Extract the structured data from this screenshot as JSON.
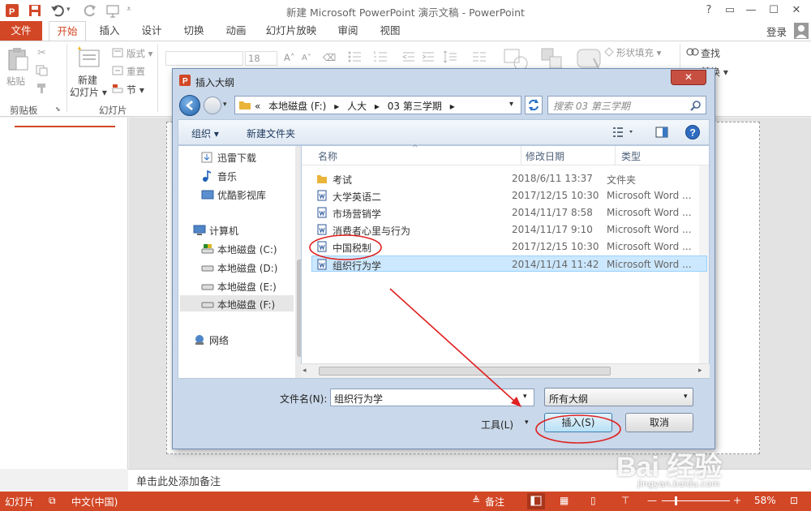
{
  "window": {
    "title": "新建 Microsoft PowerPoint 演示文稿 - PowerPoint",
    "app_icon": "P"
  },
  "window_controls": {
    "help": "?",
    "restore": "▭",
    "minimize": "—",
    "maximize": "☐",
    "close": "✕"
  },
  "tabs": {
    "file": "文件",
    "items": [
      "开始",
      "插入",
      "设计",
      "切换",
      "动画",
      "幻灯片放映",
      "审阅",
      "视图"
    ]
  },
  "signin": "登录",
  "ribbon": {
    "paste": "粘贴",
    "clipboard_group": "剪贴板",
    "new_slide": "新建\n幻灯片",
    "new_slide_line1": "新建",
    "new_slide_line2": "幻灯片 ▾",
    "layout": "版式 ▾",
    "reset": "重置",
    "section": "节 ▾",
    "slides_group": "幻灯片",
    "font_size": "18",
    "shape_fill": "形状填充 ▾",
    "find": "查找",
    "replace": "替换 ▾"
  },
  "dialog": {
    "title": "插入大纲",
    "address": [
      "«",
      "本地磁盘 (F:)",
      "▸",
      "人大",
      "▸",
      "03 第三学期",
      "▸"
    ],
    "search_placeholder": "搜索 03 第三学期",
    "organize": "组织 ▾",
    "new_folder": "新建文件夹",
    "nav_items": {
      "xunlei": "迅雷下载",
      "music": "音乐",
      "youku": "优酷影视库",
      "computer": "计算机",
      "drive_c": "本地磁盘 (C:)",
      "drive_d": "本地磁盘 (D:)",
      "drive_e": "本地磁盘 (E:)",
      "drive_f": "本地磁盘 (F:)",
      "network": "网络"
    },
    "columns": {
      "name": "名称",
      "date": "修改日期",
      "type": "类型"
    },
    "files": [
      {
        "name": "考试",
        "date": "2018/6/11 13:37",
        "type": "文件夹"
      },
      {
        "name": "大学英语二",
        "date": "2017/12/15 10:30",
        "type": "Microsoft Word ..."
      },
      {
        "name": "市场营销学",
        "date": "2014/11/17 8:58",
        "type": "Microsoft Word ..."
      },
      {
        "name": "消费者心里与行为",
        "date": "2014/11/17 9:10",
        "type": "Microsoft Word ..."
      },
      {
        "name": "中国税制",
        "date": "2017/12/15 10:30",
        "type": "Microsoft Word ..."
      },
      {
        "name": "组织行为学",
        "date": "2014/11/14 11:42",
        "type": "Microsoft Word ..."
      }
    ],
    "filename_label": "文件名(N):",
    "filename_value": "组织行为学",
    "filter": "所有大纲",
    "tools": "工具(L)",
    "insert": "插入(S)",
    "cancel": "取消"
  },
  "notes_placeholder": "单击此处添加备注",
  "status": {
    "slide": "幻灯片",
    "language": "中文(中国)",
    "notes": "备注",
    "zoom": "58%"
  },
  "watermark": {
    "text": "Bai 经验",
    "url": "jingyan.baidu.com"
  },
  "colors": {
    "accent": "#d24726",
    "annotation": "#e02020",
    "selection": "#cce8ff"
  }
}
